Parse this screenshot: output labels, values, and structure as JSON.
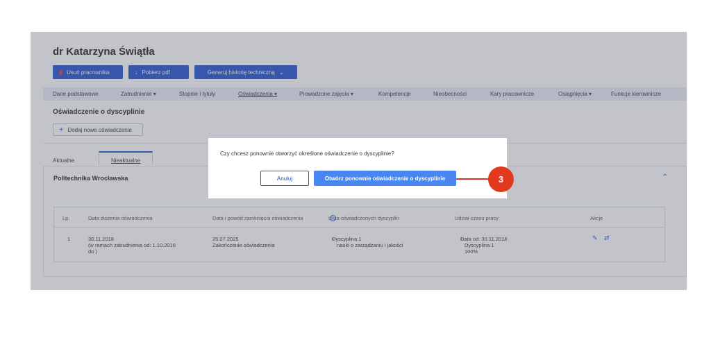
{
  "employee": {
    "name": "dr Katarzyna Świątła"
  },
  "actions": {
    "delete_label": "Usuń pracownika",
    "download_label": "Pobierz pdf",
    "history_label": "Generuj historię techniczną"
  },
  "nav": {
    "items": [
      {
        "label": "Dane podstawowe"
      },
      {
        "label": "Zatrudnienie"
      },
      {
        "label": "Stopnie i tytuły"
      },
      {
        "label": "Oświadczenia"
      },
      {
        "label": "Prowadzone zajęcia"
      },
      {
        "label": "Kompetencje"
      },
      {
        "label": "Nieobecności"
      },
      {
        "label": "Kary pracownicze"
      },
      {
        "label": "Osiągnięcia"
      },
      {
        "label": "Funkcje kierownicze"
      }
    ],
    "active": "Oświadczenia"
  },
  "declaration": {
    "title": "Oświadczenie o dyscyplinie",
    "add_label": "Dodaj nowe oświadczenie"
  },
  "tabs": {
    "current": "Aktualne",
    "inactive": "Nieaktualne",
    "selected": "Nieaktualne"
  },
  "section": {
    "title": "Politechnika Wrocławska"
  },
  "table": {
    "headers": {
      "lp": "Lp.",
      "date": "Data złożenia oświadczenia",
      "closing": "Data i powód zamknięcia oświadczenia",
      "disciplines": "Lista oświadczonych dyscyplin",
      "share": "Udział czasu pracy",
      "actions": "Akcje"
    },
    "rows": [
      {
        "lp": "1",
        "date_line1": "30.11.2018",
        "date_line2": "(w ramach zatrudnienia od: 1.10.2016",
        "date_line3": "do )",
        "closing_line1": "25.07.2025",
        "closing_line2": "Zakończenie oświadczenia",
        "disc_line1": "Dyscyplina 1",
        "disc_line2": "nauki o zarządzaniu i jakości",
        "share_line1": "Data od: 30.11.2018",
        "share_line2": "Dyscyplina 1",
        "share_line3": "100%"
      }
    ]
  },
  "dialog": {
    "question": "Czy chcesz ponownie otworzyć określone oświadczenie o dyscyplinie?",
    "cancel_label": "Anuluj",
    "confirm_label": "Otwórz ponownie oświadczenie o dyscyplinie"
  },
  "callout": {
    "number": "3"
  },
  "colors": {
    "primary": "#1f4fcf",
    "confirm": "#4a86f0",
    "callout": "#e23a1e"
  }
}
